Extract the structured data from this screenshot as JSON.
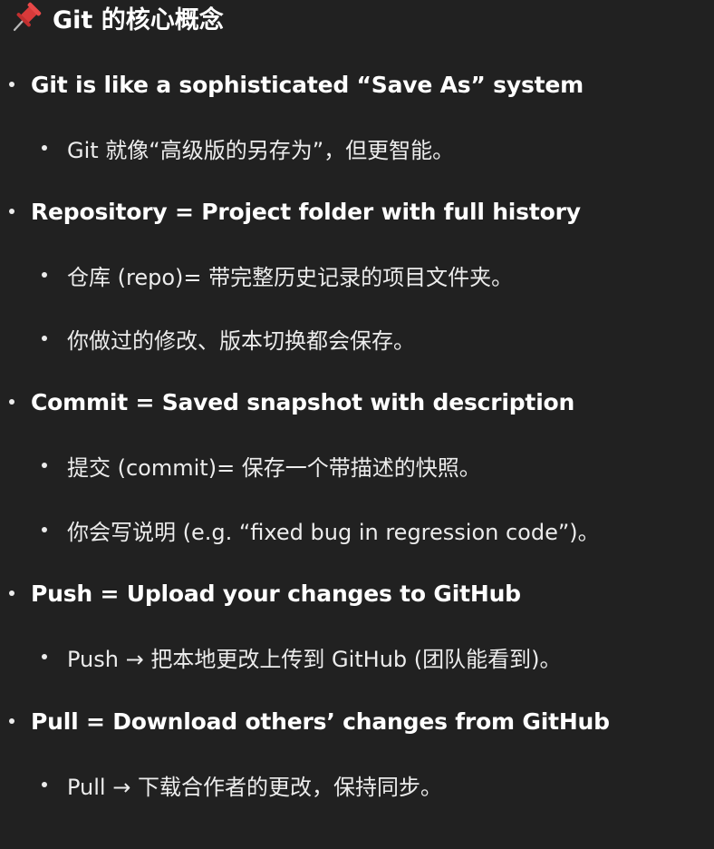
{
  "title": {
    "icon": "pushpin-icon",
    "text": "Git 的核心概念"
  },
  "items": [
    {
      "text": "Git is like a sophisticated “Save As” system",
      "children": [
        "Git 就像“高级版的另存为”，但更智能。"
      ]
    },
    {
      "text": "Repository = Project folder with full history",
      "children": [
        "仓库 (repo)= 带完整历史记录的项目文件夹。",
        "你做过的修改、版本切换都会保存。"
      ]
    },
    {
      "text": "Commit = Saved snapshot with description",
      "children": [
        "提交 (commit)= 保存一个带描述的快照。",
        "你会写说明 (e.g. “fixed bug in regression code”)。"
      ]
    },
    {
      "text": "Push = Upload your changes to GitHub",
      "children": [
        "Push → 把本地更改上传到 GitHub (团队能看到)。"
      ]
    },
    {
      "text": "Pull = Download others’ changes from GitHub",
      "children": [
        "Pull → 下载合作者的更改，保持同步。"
      ]
    }
  ]
}
